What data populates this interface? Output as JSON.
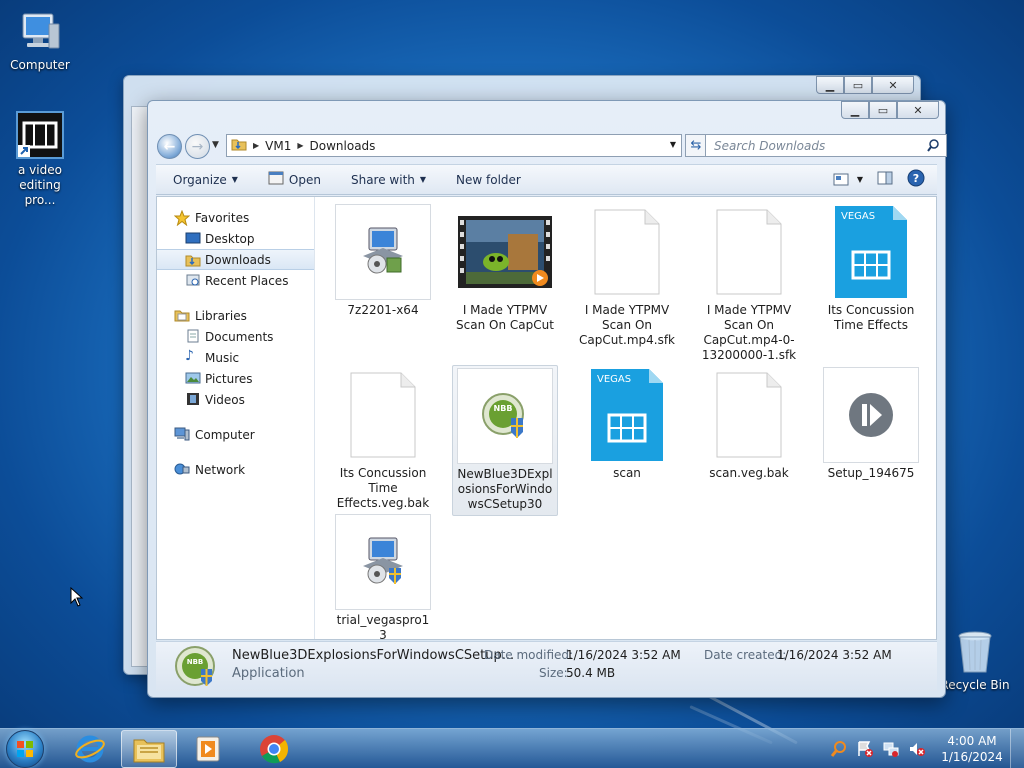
{
  "desktop": {
    "icons": [
      {
        "label": "Computer",
        "icon": "computer-icon"
      },
      {
        "label": "a video editing pro...",
        "icon": "film-shortcut-icon"
      },
      {
        "label": "Recycle Bin",
        "icon": "recycle-bin-icon"
      }
    ]
  },
  "back_window": {
    "controls": [
      "minimize",
      "maximize",
      "close"
    ]
  },
  "explorer": {
    "breadcrumb": [
      "VM1",
      "Downloads"
    ],
    "search_placeholder": "Search Downloads",
    "toolbar": {
      "organize": "Organize",
      "open": "Open",
      "share_with": "Share with",
      "new_folder": "New folder"
    },
    "nav": {
      "favorites": "Favorites",
      "desktop": "Desktop",
      "downloads": "Downloads",
      "recent_places": "Recent Places",
      "libraries": "Libraries",
      "documents": "Documents",
      "music": "Music",
      "pictures": "Pictures",
      "videos": "Videos",
      "computer": "Computer",
      "network": "Network"
    },
    "files": [
      {
        "name": "7z2201-x64",
        "icon": "installer-icon"
      },
      {
        "name": "I Made YTPMV Scan On CapCut",
        "icon": "video-thumbnail-icon"
      },
      {
        "name": "I Made YTPMV Scan On CapCut.mp4.sfk",
        "icon": "blank-file-icon"
      },
      {
        "name": "I Made YTPMV Scan On CapCut.mp4-0-13200000-1.sfk",
        "icon": "blank-file-icon"
      },
      {
        "name": "Its Concussion Time Effects",
        "icon": "vegas-project-icon"
      },
      {
        "name": "Its Concussion Time Effects.veg.bak",
        "icon": "blank-file-icon"
      },
      {
        "name": "NewBlue3DExplosionsForWindowsCSetup30",
        "icon": "newblue-setup-icon"
      },
      {
        "name": "scan",
        "icon": "vegas-project-icon"
      },
      {
        "name": "scan.veg.bak",
        "icon": "blank-file-icon"
      },
      {
        "name": "Setup_194675",
        "icon": "media-setup-icon"
      },
      {
        "name": "trial_vegaspro13",
        "icon": "installer-icon"
      }
    ],
    "details": {
      "name": "NewBlue3DExplosionsForWindowsCSetup...",
      "type": "Application",
      "modified_label": "Date modified:",
      "modified_value": "1/16/2024 3:52 AM",
      "created_label": "Date created:",
      "created_value": "1/16/2024 3:52 AM",
      "size_label": "Size:",
      "size_value": "50.4 MB"
    }
  },
  "taskbar": {
    "pinned": [
      "internet-explorer-icon",
      "windows-explorer-icon",
      "media-player-icon",
      "chrome-icon"
    ],
    "clock_time": "4:00 AM",
    "clock_date": "1/16/2024"
  },
  "colors": {
    "accent": "#1f77c9",
    "vegas_blue": "#1aa0e0"
  }
}
